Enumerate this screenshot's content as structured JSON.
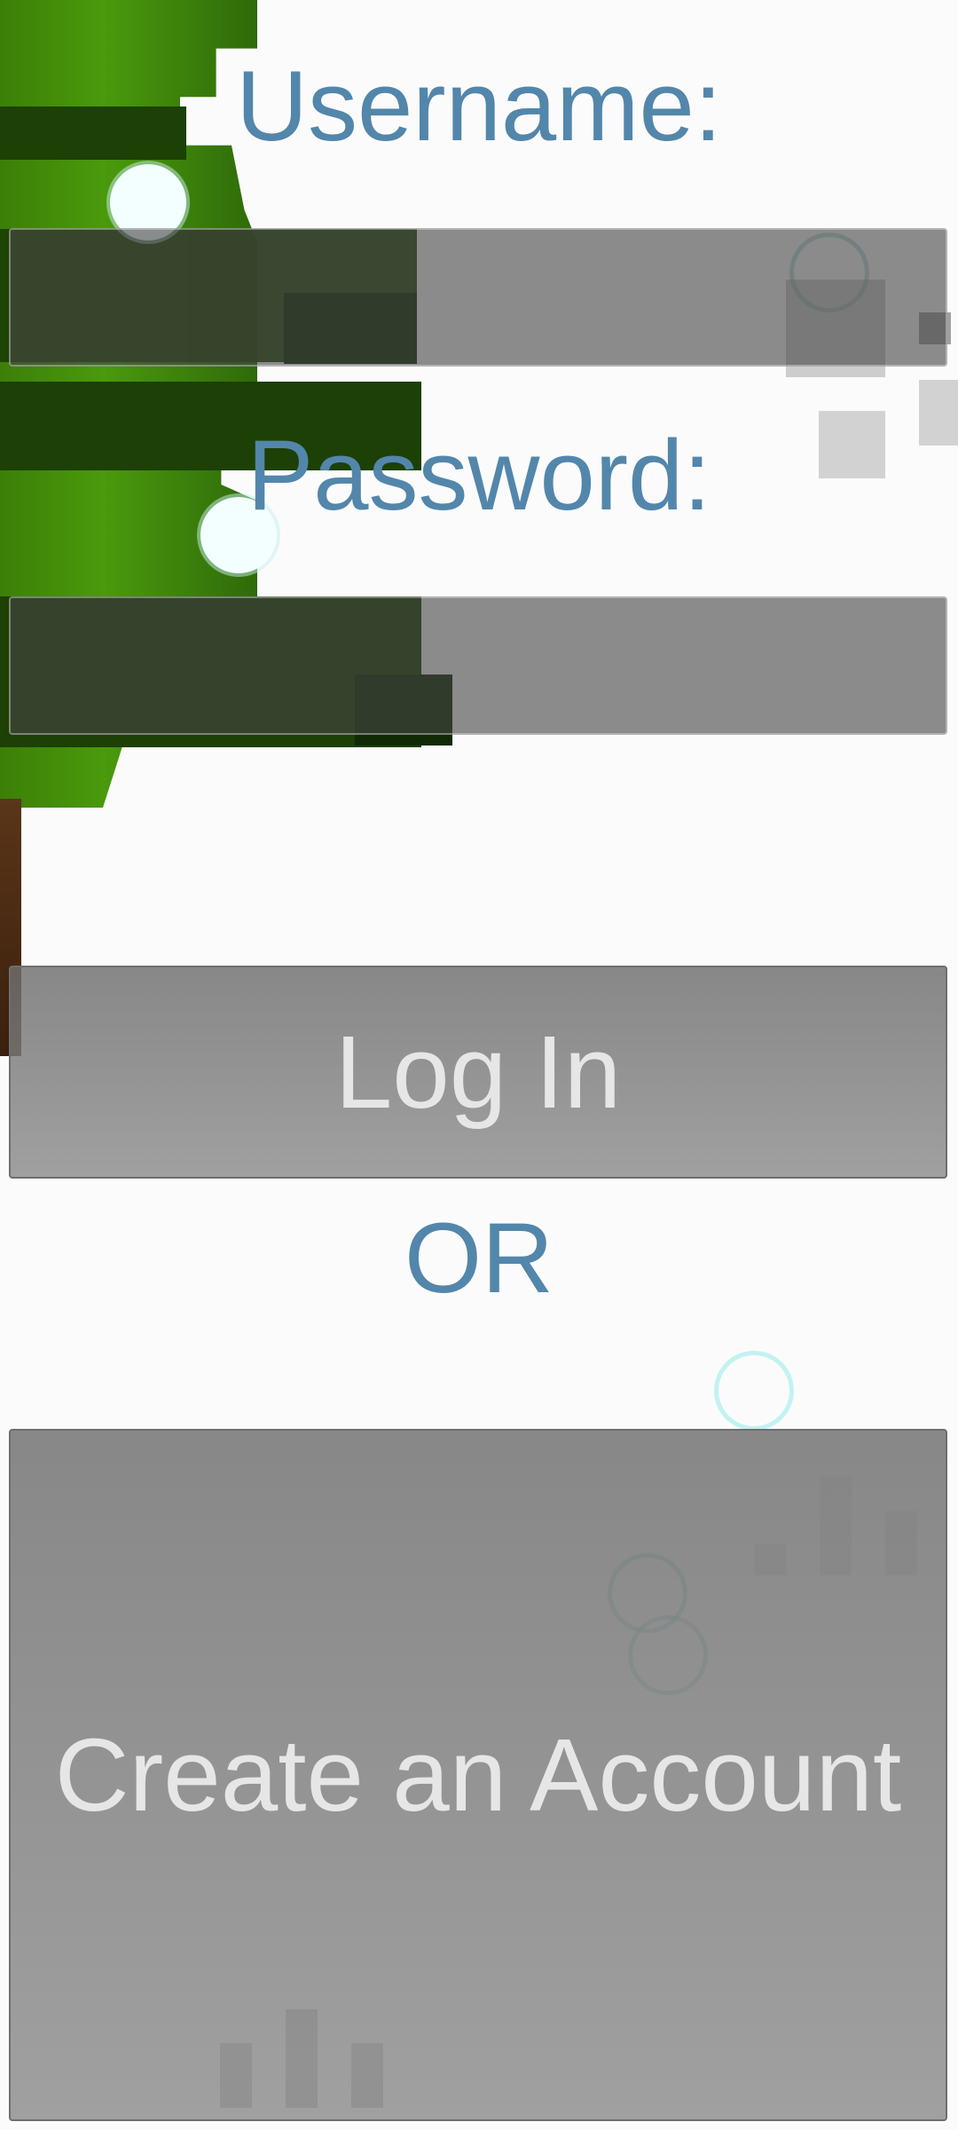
{
  "form": {
    "username_label": "Username:",
    "username_value": "",
    "password_label": "Password:",
    "password_value": "",
    "login_button": "Log In",
    "separator": "OR",
    "create_account_button": "Create an Account"
  },
  "colors": {
    "label_text": "#5386ab",
    "button_text": "#e6e6e6",
    "field_background": "#5a5a5a",
    "page_background": "#fbfbfb"
  }
}
